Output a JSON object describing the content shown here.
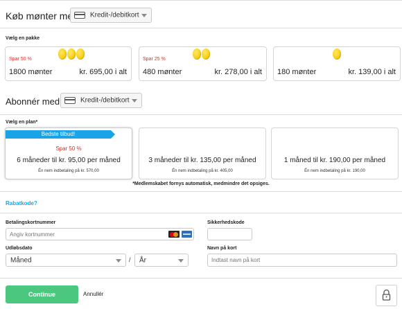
{
  "buy_section": {
    "title": "Køb mønter med",
    "payment_select": "Kredit-/debitkort"
  },
  "packages": {
    "label": "Vælg en pakke",
    "items": [
      {
        "save": "Spar 50 %",
        "coins": "1800 mønter",
        "price": "kr. 695,00 i alt",
        "coin_count": 3
      },
      {
        "save": "Spar 25 %",
        "coins": "480 mønter",
        "price": "kr. 278,00 i alt",
        "coin_count": 2
      },
      {
        "save": "",
        "coins": "180 mønter",
        "price": "kr. 139,00 i alt",
        "coin_count": 1
      }
    ]
  },
  "subscribe_section": {
    "title": "Abonnér med",
    "payment_select": "Kredit-/debitkort"
  },
  "plans": {
    "label": "Vælg en plan*",
    "items": [
      {
        "ribbon": "Bedste tilbud!",
        "save": "Spar 50 %",
        "title": "6 måneder til kr. 95,00 per måned",
        "sub": "Én nem indbetaling på kr. 570,00"
      },
      {
        "ribbon": "",
        "save": "",
        "title": "3 måneder til kr. 135,00 per måned",
        "sub": "Én nem indbetaling på kr. 405,00"
      },
      {
        "ribbon": "",
        "save": "",
        "title": "1 måned til kr. 190,00 per måned",
        "sub": "Én nem indbetaling på kr. 190,00"
      }
    ],
    "note": "*Medlemskabet fornys automatisk, medmindre det opsiges."
  },
  "discount": {
    "link": "Rabatkode?"
  },
  "card_form": {
    "card_number_label": "Betalingskortnummer",
    "card_number_placeholder": "Angiv kortnummer",
    "security_label": "Sikkerhedskode",
    "expiry_label": "Udløbsdato",
    "month_select": "Måned",
    "year_select": "År",
    "separator": "/",
    "name_label": "Navn på kort",
    "name_placeholder": "Indtast navn på kort"
  },
  "actions": {
    "continue": "Continue",
    "cancel": "Annullér"
  },
  "colors": {
    "accent_blue": "#1aa3e6",
    "continue_green": "#4cc77f",
    "save_red": "#d0342c",
    "coin_gold": "#f9cd12"
  }
}
